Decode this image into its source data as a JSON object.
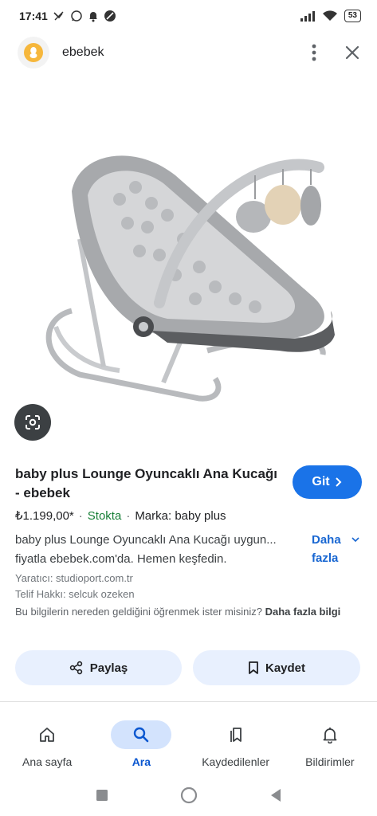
{
  "status_bar": {
    "time": "17:41",
    "battery": "53"
  },
  "header": {
    "site_name": "ebebek"
  },
  "product": {
    "title": "baby plus Lounge Oyuncaklı Ana Kucağı - ebebek",
    "go_label": "Git",
    "price": "₺1.199,00*",
    "stock": "Stokta",
    "brand": "Marka: baby plus",
    "description_line1": "baby plus Lounge Oyuncaklı Ana Kucağı uygun...",
    "description_line2": "fiyatla ebebek.com'da. Hemen keşfedin.",
    "more_label_1": "Daha",
    "more_label_2": "fazla",
    "creator": "Yaratıcı: studioport.com.tr",
    "copyright": "Telif Hakkı: selcuk ozeken",
    "info_question": "Bu bilgilerin nereden geldiğini öğrenmek ister misiniz?",
    "info_link": "Daha fazla bilgi"
  },
  "actions": {
    "share_label": "Paylaş",
    "save_label": "Kaydet"
  },
  "bottom_nav": {
    "items": [
      {
        "label": "Ana sayfa",
        "icon": "home-icon",
        "active": false
      },
      {
        "label": "Ara",
        "icon": "search-icon",
        "active": true
      },
      {
        "label": "Kaydedilenler",
        "icon": "bookmarks-icon",
        "active": false
      },
      {
        "label": "Bildirimler",
        "icon": "bell-icon",
        "active": false
      }
    ]
  },
  "colors": {
    "accent": "#1a73e8",
    "stock": "#188038",
    "active_pill": "#d3e3fd",
    "action_bg": "#e8f0fe"
  }
}
